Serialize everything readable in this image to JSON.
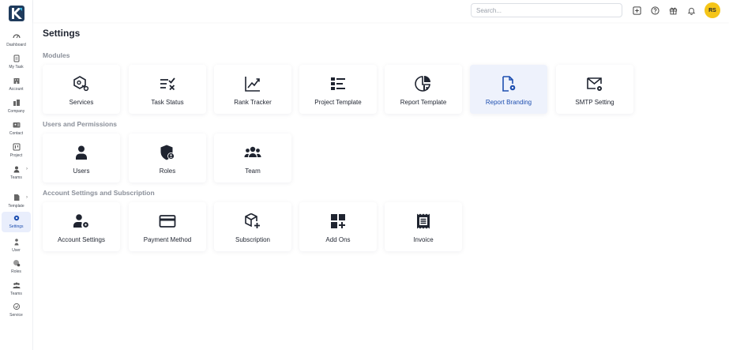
{
  "sidebar": {
    "items": [
      {
        "label": "Dashboard",
        "icon": "dashboard-icon"
      },
      {
        "label": "My Task",
        "icon": "clipboard-icon"
      },
      {
        "label": "Account",
        "icon": "building-icon"
      },
      {
        "label": "Company",
        "icon": "company-icon"
      },
      {
        "label": "Contact",
        "icon": "contact-card-icon"
      },
      {
        "label": "Project",
        "icon": "project-icon"
      },
      {
        "label": "Teams",
        "icon": "team-icon"
      },
      {
        "label": "Template",
        "icon": "template-icon"
      },
      {
        "label": "Settings",
        "icon": "gear-icon"
      },
      {
        "label": "User",
        "icon": "user-icon"
      },
      {
        "label": "Roles",
        "icon": "roles-icon"
      },
      {
        "label": "Teams",
        "icon": "team-icon"
      },
      {
        "label": "Service",
        "icon": "service-icon"
      }
    ],
    "caret": "›"
  },
  "topbar": {
    "search_placeholder": "Search...",
    "avatar_initials": "RS"
  },
  "page": {
    "title": "Settings"
  },
  "sections": {
    "modules": {
      "title": "Modules",
      "cards": [
        {
          "label": "Services"
        },
        {
          "label": "Task Status"
        },
        {
          "label": "Rank Tracker"
        },
        {
          "label": "Project Template"
        },
        {
          "label": "Report Template"
        },
        {
          "label": "Report Branding"
        },
        {
          "label": "SMTP Setting"
        }
      ]
    },
    "users": {
      "title": "Users and Permissions",
      "cards": [
        {
          "label": "Users"
        },
        {
          "label": "Roles"
        },
        {
          "label": "Team"
        }
      ]
    },
    "account": {
      "title": "Account Settings and Subscription",
      "cards": [
        {
          "label": "Account Settings"
        },
        {
          "label": "Payment Method"
        },
        {
          "label": "Subscription"
        },
        {
          "label": "Add Ons"
        },
        {
          "label": "Invoice"
        }
      ]
    }
  },
  "colors": {
    "accent": "#1e4fb0",
    "active_bg": "#eef2fc",
    "avatar_bg": "#f5c518"
  }
}
